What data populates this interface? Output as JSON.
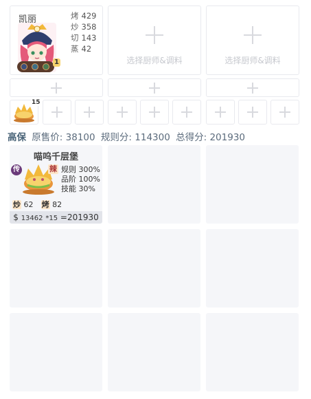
{
  "chef": {
    "name": "凯丽",
    "stats": [
      {
        "label": "烤",
        "value": "429"
      },
      {
        "label": "炒",
        "value": "358"
      },
      {
        "label": "切",
        "value": "143"
      },
      {
        "label": "蒸",
        "value": "42"
      }
    ],
    "badge": "1",
    "empty_slot_label": "选择厨师&调料"
  },
  "dish_slot": {
    "qty": "15"
  },
  "summary": {
    "grade": "高保",
    "original_price_label": "原售价:",
    "original_price": "38100",
    "rule_score_label": "规则分:",
    "rule_score": "114300",
    "total_label": "总得分:",
    "total": "201930"
  },
  "recipe": {
    "name": "喵呜千层堡",
    "rarity": "传",
    "flavor": "辣",
    "rule": "规则 300%",
    "grade": "品阶 100%",
    "skill": "技能 30%",
    "skills": [
      {
        "label": "炒",
        "value": "62"
      },
      {
        "label": "烤",
        "value": "82"
      }
    ],
    "price_symbol": "$",
    "unit_price": "13462",
    "qty": "*15",
    "result": "=201930"
  },
  "colors": {
    "accent": "#5b6b7c",
    "card_bg": "#f5f6f9",
    "rarity_bg": "#6a3a7a"
  }
}
